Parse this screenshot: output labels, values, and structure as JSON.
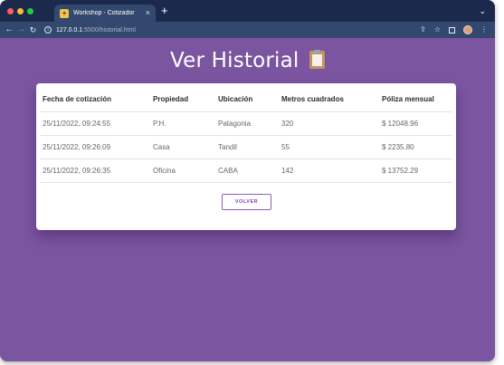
{
  "browser": {
    "tab_title": "Workshop - Cotizador",
    "tab_close": "×",
    "new_tab": "+",
    "url_host": "127.0.0.1",
    "url_path": ":5500/historial.html"
  },
  "page": {
    "title": "Ver Historial",
    "title_icon": "clipboard-icon"
  },
  "table": {
    "headers": [
      "Fecha de cotización",
      "Propiedad",
      "Ubicación",
      "Metros cuadrados",
      "Póliza mensual"
    ],
    "rows": [
      [
        "25/11/2022, 09:24:55",
        "P.H.",
        "Patagonia",
        "320",
        "$ 12048.96"
      ],
      [
        "25/11/2022, 09:26:09",
        "Casa",
        "Tandil",
        "55",
        "$ 2235.80"
      ],
      [
        "25/11/2022, 09:26:35",
        "Oficina",
        "CABA",
        "142",
        "$ 13752.29"
      ]
    ]
  },
  "actions": {
    "back_label": "VOLVER"
  },
  "colors": {
    "page_background": "#7b55a0",
    "tabstrip": "#1b2a4c",
    "toolbar": "#33486f",
    "button_accent": "#7b3fb0"
  }
}
